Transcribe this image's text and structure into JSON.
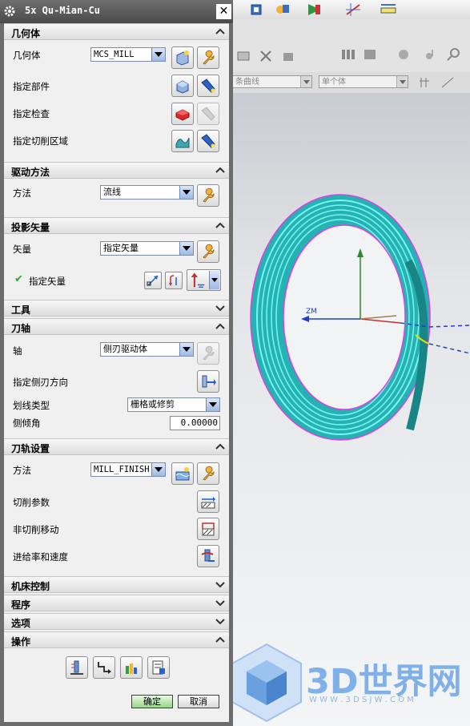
{
  "dialog": {
    "title": "5x Qu-Mian-Cu",
    "close_label": "✕"
  },
  "geometry": {
    "header": "几何体",
    "geometry_label": "几何体",
    "geometry_value": "MCS_MILL",
    "specify_part_label": "指定部件",
    "specify_check_label": "指定检查",
    "specify_cut_area_label": "指定切削区域"
  },
  "drive_method": {
    "header": "驱动方法",
    "method_label": "方法",
    "method_value": "流线"
  },
  "projection_vector": {
    "header": "投影矢量",
    "vector_label": "矢量",
    "vector_value": "指定矢量",
    "specify_vector_label": "指定矢量",
    "check_mark": "✔"
  },
  "tool": {
    "header": "工具"
  },
  "tool_axis": {
    "header": "刀轴",
    "axis_label": "轴",
    "axis_value": "侧刃驱动体",
    "side_blade_dir_label": "指定侧刃方向",
    "line_type_label": "划线类型",
    "line_type_value": "栅格或修剪",
    "tilt_angle_label": "侧倾角",
    "tilt_angle_value": "0.00000"
  },
  "path_settings": {
    "header": "刀轨设置",
    "method_label": "方法",
    "method_value": "MILL_FINISH",
    "cut_params_label": "切削参数",
    "non_cut_moves_label": "非切削移动",
    "feeds_speeds_label": "进给率和速度"
  },
  "machine_control": {
    "header": "机床控制"
  },
  "program": {
    "header": "程序"
  },
  "options": {
    "header": "选项"
  },
  "actions": {
    "header": "操作"
  },
  "footer": {
    "ok_label": "确定",
    "cancel_label": "取消"
  },
  "cad": {
    "combo1_value": "条曲线",
    "combo2_value": "单个体",
    "axis_label": "ZM"
  },
  "watermark": {
    "brand": "3D世界网",
    "url": "W W W . 3 D S J W . C O M"
  },
  "colors": {
    "accent_blue": "#1f5fd1",
    "part_cyan": "#2fe0e0",
    "ok_green": "#98d58a"
  }
}
